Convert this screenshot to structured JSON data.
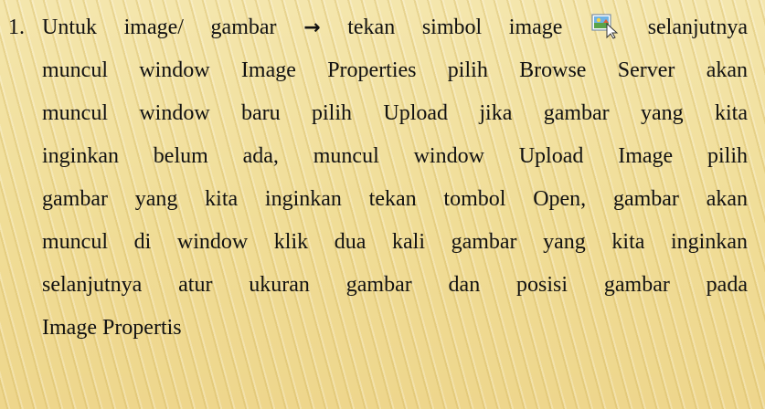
{
  "list_item": {
    "number": "1.",
    "line1_part1": "Untuk image/ gambar ",
    "arrow": "→",
    "line1_part2": " tekan simbol image ",
    "line1_part3": " selanjutnya",
    "line2": "muncul window Image Properties pilih Browse Server akan",
    "line3": "muncul window baru pilih Upload jika gambar yang kita",
    "line4": "inginkan belum ada, muncul window Upload Image pilih",
    "line5": "gambar yang kita inginkan tekan tombol Open, gambar akan",
    "line6": "muncul di window klik dua kali gambar yang kita inginkan",
    "line7": "selanjutnya atur ukuran gambar dan posisi gambar pada",
    "line8": "Image Propertis"
  },
  "icons": {
    "image_toolbar_icon": "image-icon"
  },
  "colors": {
    "background": "#f2e2a2",
    "text": "#111111"
  }
}
